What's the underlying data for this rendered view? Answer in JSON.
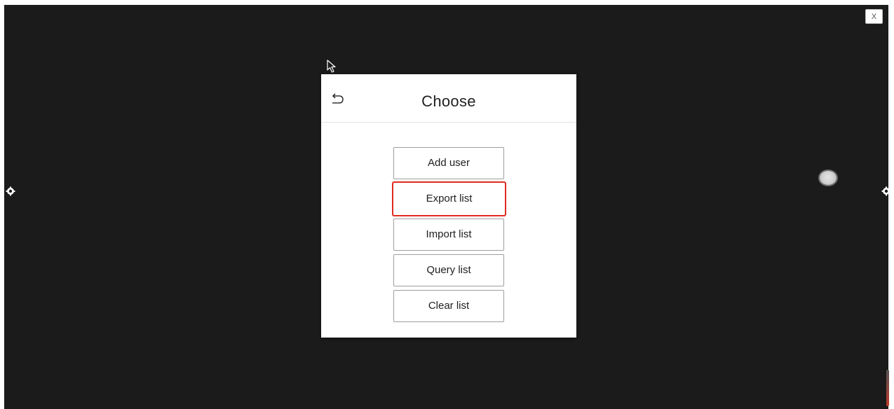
{
  "window": {
    "close_label": "X"
  },
  "dialog": {
    "title": "Choose",
    "back_icon": "undo-arrow-icon",
    "buttons": [
      {
        "label": "Add user"
      },
      {
        "label": "Export list",
        "highlighted": true
      },
      {
        "label": "Import list"
      },
      {
        "label": "Query list"
      },
      {
        "label": "Clear list"
      }
    ]
  },
  "icons": {
    "left_side": "gear-icon",
    "right_side": "gear-icon",
    "cursor": "mouse-pointer-icon",
    "floating": "floating-button-icon"
  },
  "colors": {
    "background": "#1b1b1b",
    "dialog": "#ffffff",
    "highlight": "#e02a20"
  }
}
